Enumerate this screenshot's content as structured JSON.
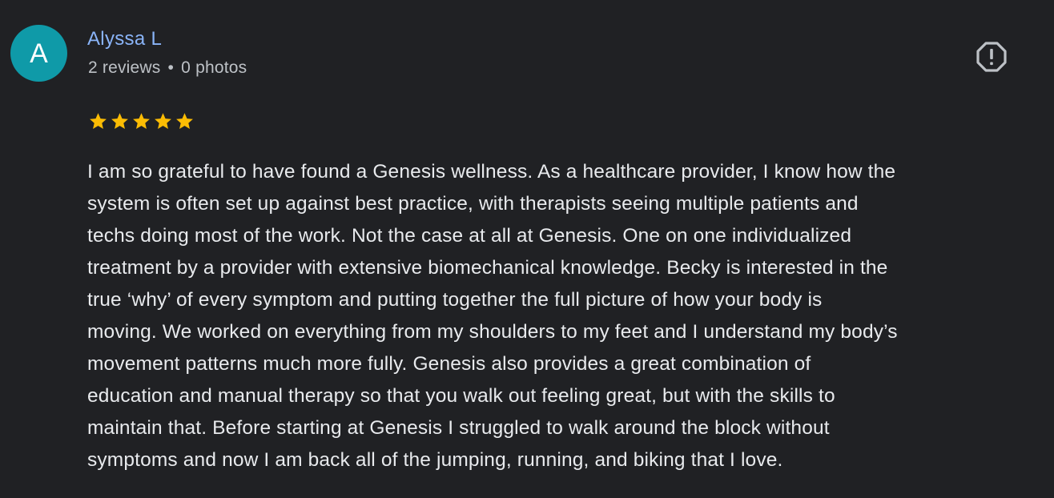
{
  "review": {
    "avatar_letter": "A",
    "author_name": "Alyssa L",
    "reviews_count": "2 reviews",
    "separator": "•",
    "photos_count": "0 photos",
    "rating": 5,
    "rating_max": 5,
    "star_color": "#fbbc04",
    "accent_color": "#8ab4f8",
    "avatar_color": "#0f9aa8",
    "report_icon": "report-flag-icon",
    "text_lines": [
      "I am so grateful to have found a Genesis wellness. As a healthcare provider, I know how the",
      "system is often set up against best practice, with therapists seeing multiple patients and",
      "techs doing most of the work. Not the case at all at Genesis. One on one individualized",
      "treatment by a provider with extensive biomechanical knowledge. Becky is interested in the",
      "true ‘why’ of every symptom and putting together the full picture of how your body is",
      "moving. We worked on everything from my shoulders to my feet and I understand my body’s",
      "movement patterns much more fully. Genesis also provides a great combination of",
      "education and manual therapy so that you walk out feeling great, but with the skills to",
      "maintain that. Before starting at Genesis I struggled to walk around the block without",
      "symptoms and now I am back all of the jumping, running, and biking that I love."
    ]
  }
}
